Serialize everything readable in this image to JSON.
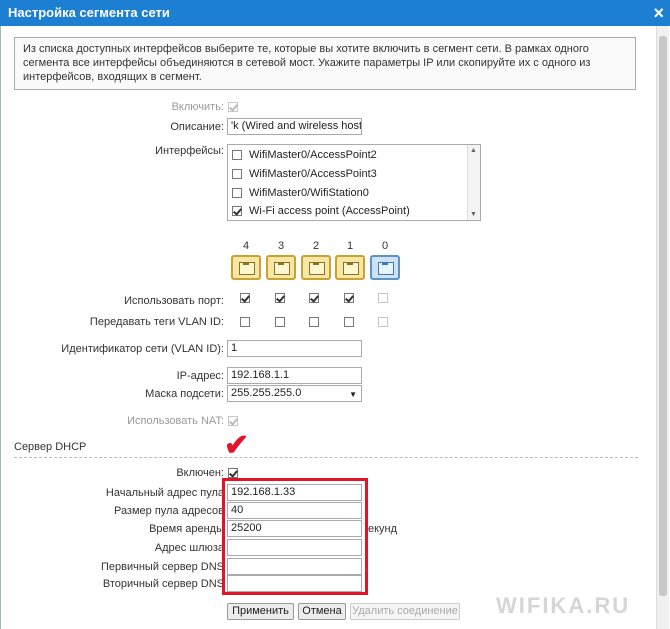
{
  "window": {
    "title": "Настройка сегмента сети",
    "close_label": "×"
  },
  "info_text": "Из списка доступных интерфейсов выберите те, которые вы хотите включить в сегмент сети. В рамках одного сегмента все интерфейсы объединяются в сетевой мост. Укажите параметры IP или скопируйте их с одного из интерфейсов, входящих в сегмент.",
  "form": {
    "enable_label": "Включить:",
    "description_label": "Описание:",
    "description_value": "'k (Wired and wireless hosts)",
    "interfaces_label": "Интерфейсы:",
    "interfaces": [
      {
        "label": "WifiMaster0/AccessPoint2",
        "checked": false
      },
      {
        "label": "WifiMaster0/AccessPoint3",
        "checked": false
      },
      {
        "label": "WifiMaster0/WifiStation0",
        "checked": false
      },
      {
        "label": "Wi-Fi access point (AccessPoint)",
        "checked": true
      }
    ],
    "ports": [
      "4",
      "3",
      "2",
      "1",
      "0"
    ],
    "use_port_label": "Использовать порт:",
    "vlan_tags_label": "Передавать теги VLAN ID:",
    "vlan_id_label": "Идентификатор сети (VLAN ID):",
    "vlan_id_value": "1",
    "ip_label": "IP-адрес:",
    "ip_value": "192.168.1.1",
    "mask_label": "Маска подсети:",
    "mask_value": "255.255.255.0",
    "nat_label": "Использовать NAT:"
  },
  "dhcp": {
    "section_title": "Сервер DHCP",
    "enabled_label": "Включен:",
    "start_label": "Начальный адрес пула",
    "start_value": "192.168.1.33",
    "pool_size_label": "Размер пула адресов",
    "pool_size_value": "40",
    "lease_label": "Время аренды",
    "lease_value": "25200",
    "lease_unit": "екунд",
    "gateway_label": "Адрес шлюза",
    "gateway_value": "",
    "dns1_label": "Первичный сервер DNS",
    "dns1_value": "",
    "dns2_label": "Вторичный сервер DNS",
    "dns2_value": ""
  },
  "buttons": {
    "apply": "Применить",
    "cancel": "Отмена",
    "delete": "Удалить соединение"
  },
  "watermark": "WIFIKA.RU",
  "colors": {
    "titlebar": "#1d7fd1",
    "highlight": "#e1142b"
  }
}
